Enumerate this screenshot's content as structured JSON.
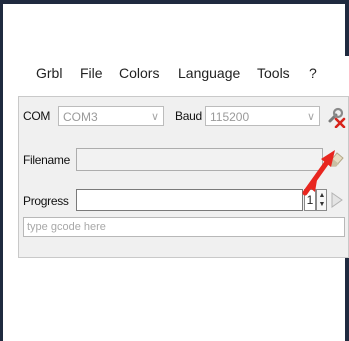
{
  "menubar": {
    "items": [
      "Grbl",
      "File",
      "Colors",
      "Language",
      "Tools",
      "?"
    ]
  },
  "connection": {
    "com_label": "COM",
    "com_value": "COM3",
    "baud_label": "Baud",
    "baud_value": "115200"
  },
  "file": {
    "filename_label": "Filename",
    "filename_value": ""
  },
  "progress": {
    "label": "Progress",
    "spinner_value": "1"
  },
  "gcode": {
    "placeholder": "type gcode here"
  },
  "icons": {
    "connect": "wrench-disconnect-icon",
    "clear": "eraser-icon",
    "run": "play-triangle-icon",
    "annotation": "red-arrow-pointer"
  },
  "colors": {
    "frame": "#1f2a3f",
    "annotation_arrow": "#e8261f",
    "panel": "#f0f0f0"
  }
}
